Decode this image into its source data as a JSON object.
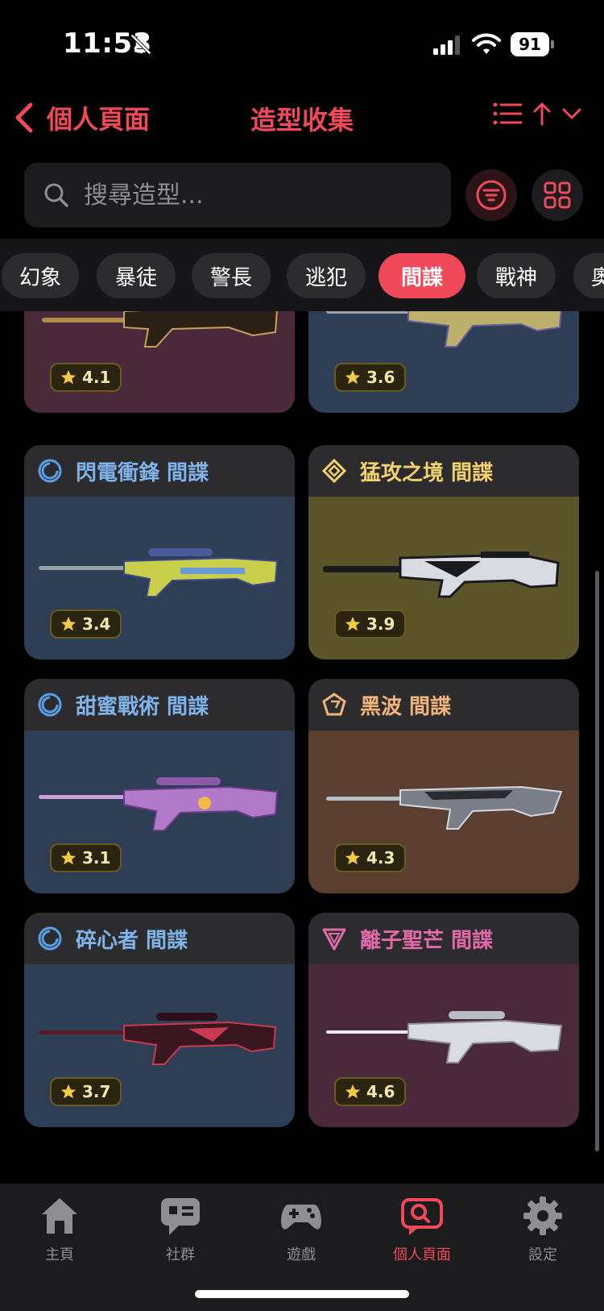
{
  "status_bar": {
    "time": "11:53",
    "battery": "91"
  },
  "nav": {
    "back_label": "個人頁面",
    "title": "造型收集"
  },
  "search": {
    "placeholder": "搜尋造型..."
  },
  "categories": [
    "幻象",
    "暴徒",
    "警長",
    "逃犯",
    "間諜",
    "戰神",
    "奧"
  ],
  "active_category": "間諜",
  "cards": [
    {
      "title": "",
      "rating": "4.1",
      "tier_icon": "none",
      "bg": "#4a2a3a"
    },
    {
      "title": "",
      "rating": "3.6",
      "tier_icon": "none",
      "bg": "#2d3e55"
    },
    {
      "title": "閃電衝鋒 間諜",
      "rating": "3.4",
      "tier_icon": "select-tier-icon",
      "title_color": "#7fb3ea",
      "bg": "#2d3e55"
    },
    {
      "title": "猛攻之境 間諜",
      "rating": "3.9",
      "tier_icon": "deluxe-tier-icon",
      "title_color": "#f2d36b",
      "bg": "#5c552a"
    },
    {
      "title": "甜蜜戰術 間諜",
      "rating": "3.1",
      "tier_icon": "select-tier-icon",
      "title_color": "#7fb3ea",
      "bg": "#2d3e55"
    },
    {
      "title": "黑波 間諜",
      "rating": "4.3",
      "tier_icon": "exclusive-tier-icon",
      "title_color": "#f2b47a",
      "bg": "#5a3f30"
    },
    {
      "title": "碎心者 間諜",
      "rating": "3.7",
      "tier_icon": "select-tier-icon",
      "title_color": "#7fb3ea",
      "bg": "#2d3e55"
    },
    {
      "title": "離子聖芒 間諜",
      "rating": "4.6",
      "tier_icon": "premium-tier-icon",
      "title_color": "#e26aa8",
      "bg": "#4a2a3a"
    }
  ],
  "tabs": [
    {
      "label": "主頁",
      "icon": "home-icon"
    },
    {
      "label": "社群",
      "icon": "chat-icon"
    },
    {
      "label": "遊戲",
      "icon": "gamepad-icon"
    },
    {
      "label": "個人頁面",
      "icon": "profile-search-icon",
      "active": true
    },
    {
      "label": "設定",
      "icon": "gear-icon"
    }
  ],
  "colors": {
    "accent": "#f0495a",
    "background": "#000000",
    "surface": "#1c1c1e"
  }
}
